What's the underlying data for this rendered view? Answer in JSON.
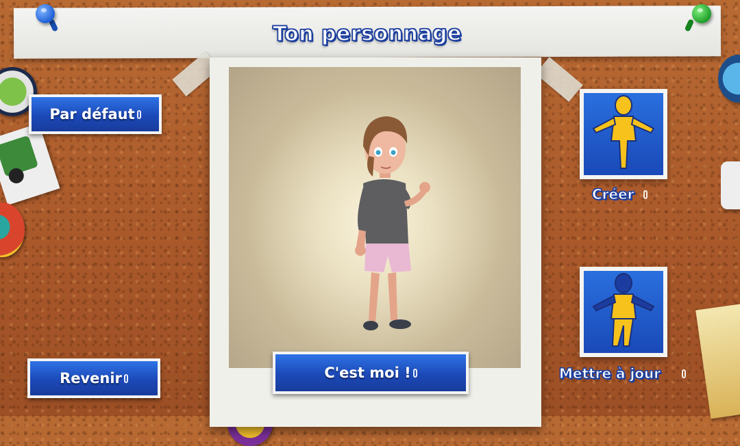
{
  "screen": {
    "title": "Ton personnage"
  },
  "buttons": {
    "default_label": "Par défaut",
    "back_label": "Revenir",
    "confirm_label": "C'est moi !"
  },
  "cards": {
    "create_label": "Créer",
    "update_label": "Mettre à jour"
  },
  "icons": {
    "voice": "microphone-icon",
    "create": "full-body-figure-icon",
    "update": "partial-body-figure-icon"
  },
  "colors": {
    "button_blue": "#1c49b8",
    "figure_yellow": "#f6c21b",
    "cork": "#a9582a",
    "title_outline": "#1c3f9e"
  }
}
